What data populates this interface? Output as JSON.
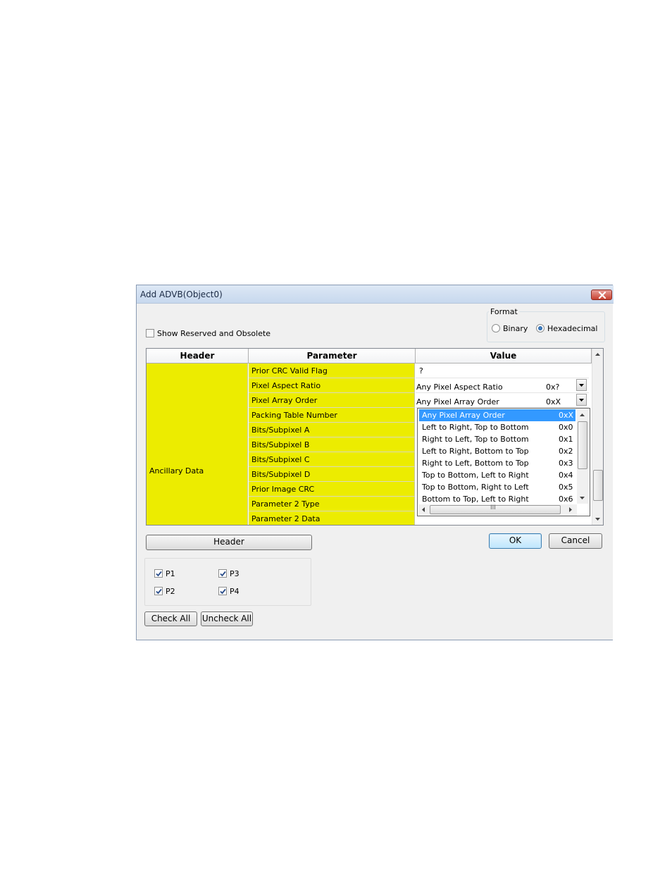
{
  "window": {
    "title": "Add ADVB(Object0)"
  },
  "options": {
    "show_reserved_label": "Show Reserved and Obsolete",
    "show_reserved_checked": false
  },
  "format": {
    "group_label": "Format",
    "binary_label": "Binary",
    "hex_label": "Hexadecimal",
    "selected": "Hexadecimal"
  },
  "grid": {
    "columns": [
      "Header",
      "Parameter",
      "Value"
    ],
    "header_value": "Ancillary Data",
    "parameters": [
      "Prior CRC Valid Flag",
      "Pixel Aspect Ratio",
      "Pixel Array Order",
      "Packing Table Number",
      "Bits/Subpixel A",
      "Bits/Subpixel B",
      "Bits/Subpixel C",
      "Bits/Subpixel D",
      "Prior Image CRC",
      "Parameter 2 Type",
      "Parameter 2 Data"
    ],
    "values": [
      {
        "text": "?"
      },
      {
        "text": "Any Pixel Aspect Ratio",
        "code": "0x?"
      },
      {
        "text": "Any Pixel Array Order",
        "code": "0xX"
      }
    ]
  },
  "dropdown": {
    "items": [
      {
        "label": "Any Pixel Array Order",
        "code": "0xX"
      },
      {
        "label": "Left to Right, Top to Bottom",
        "code": "0x0"
      },
      {
        "label": "Right to Left, Top to Bottom",
        "code": "0x1"
      },
      {
        "label": "Left to Right, Bottom to Top",
        "code": "0x2"
      },
      {
        "label": "Right to Left, Bottom to Top",
        "code": "0x3"
      },
      {
        "label": "Top to Bottom, Left to Right",
        "code": "0x4"
      },
      {
        "label": "Top to Bottom, Right to Left",
        "code": "0x5"
      },
      {
        "label": "Bottom to Top, Left to Right",
        "code": "0x6"
      }
    ],
    "hscroll_grip": "III"
  },
  "buttons": {
    "header": "Header",
    "ok": "OK",
    "cancel": "Cancel",
    "check_all": "Check All",
    "uncheck_all": "Uncheck All"
  },
  "packets": {
    "p1": "P1",
    "p2": "P2",
    "p3": "P3",
    "p4": "P4"
  },
  "colors": {
    "highlight_yellow": "#ecec00",
    "selection_blue": "#3399ff"
  }
}
